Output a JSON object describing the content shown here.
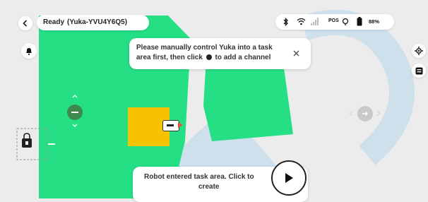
{
  "header": {
    "status_label": "Ready",
    "device_id": "(Yuka-YVU4Y6Q5)",
    "pos_label": "POS",
    "battery_percent": "88%"
  },
  "toast": {
    "line1": "Please manually control Yuka into a task",
    "line2_pre": "area first, then click",
    "line2_post": "to add a channel"
  },
  "prompt": {
    "line1": "Robot entered task area. Click to",
    "line2": "create"
  },
  "colors": {
    "area_green": "#25df85",
    "zone_yellow": "#f7c300",
    "watermark_blue": "#bcd8ef",
    "page_bg": "#ececec"
  },
  "icons": [
    "back-arrow-icon",
    "bluetooth-icon",
    "wifi-icon",
    "signal-icon",
    "gps-icon",
    "battery-icon",
    "bell-icon",
    "close-icon",
    "locate-icon",
    "robot-icon",
    "play-icon",
    "dock-icon"
  ]
}
